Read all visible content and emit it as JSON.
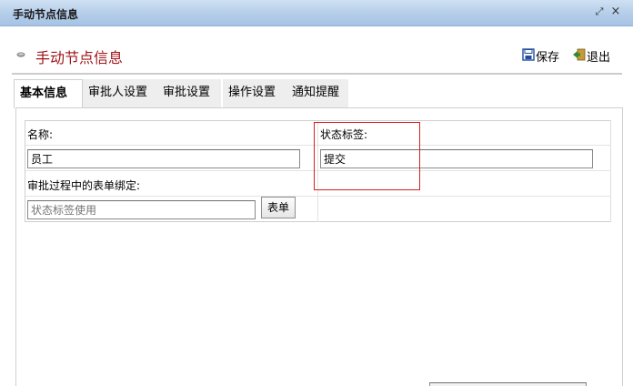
{
  "window": {
    "title": "手动节点信息",
    "max_icon": "maximize-icon",
    "close_icon": "close-icon"
  },
  "header": {
    "title": "手动节点信息",
    "title_color": "#a0151a",
    "save_label": "保存",
    "exit_label": "退出"
  },
  "tabs": [
    {
      "label": "基本信息",
      "active": true
    },
    {
      "label": "审批人设置",
      "active": false
    },
    {
      "label": "审批设置",
      "active": false
    },
    {
      "label": "操作设置",
      "active": false
    },
    {
      "label": "通知提醒",
      "active": false
    }
  ],
  "form": {
    "name_label": "名称:",
    "name_value": "员工",
    "status_label": "状态标签:",
    "status_value": "提交",
    "binding_label": "审批过程中的表单绑定:",
    "binding_placeholder": "状态标签使用",
    "form_button_label": "表单"
  },
  "colors": {
    "titlebar": "#b4cde9",
    "highlight": "#d42020"
  }
}
